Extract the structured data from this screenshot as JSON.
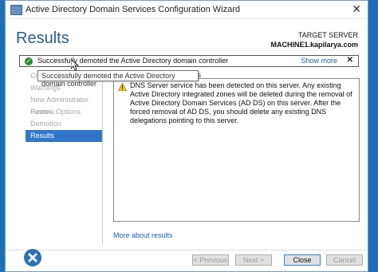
{
  "window": {
    "title": "Active Directory Domain Services Configuration Wizard"
  },
  "header": {
    "title": "Results",
    "target_server_label": "TARGET SERVER",
    "target_server_name": "MACHINE1.kapilarya.com"
  },
  "banner": {
    "text": "Successfully demoted the Active Directory domain controller",
    "show_more": "Show more",
    "close": "✕"
  },
  "tooltip": {
    "text": "Successfully demoted the Active Directory domain controller"
  },
  "sidebar": {
    "items": [
      {
        "label": "Cre"
      },
      {
        "label": "Warnings"
      },
      {
        "label": "New Administrator Passw..."
      },
      {
        "label": "Review Options"
      },
      {
        "label": "Demotion"
      },
      {
        "label": "Results"
      }
    ]
  },
  "main": {
    "results_label": "lts",
    "message": "DNS Server service has been detected on this server. Any existing Active Directory integrated zones will be deleted during the removal of Active Directory Domain Services (AD DS) on this server. After the forced removal of AD DS, you should delete any existing DNS delegations pointing to this server.",
    "more_link": "More about results"
  },
  "buttons": {
    "previous": "< Previous",
    "next": "Next >",
    "close": "Close",
    "cancel": "Cancel"
  },
  "colors": {
    "accent": "#3177c9",
    "success": "#2e8b2e",
    "warning": "#f0c419",
    "background": "#1e6fb8"
  }
}
